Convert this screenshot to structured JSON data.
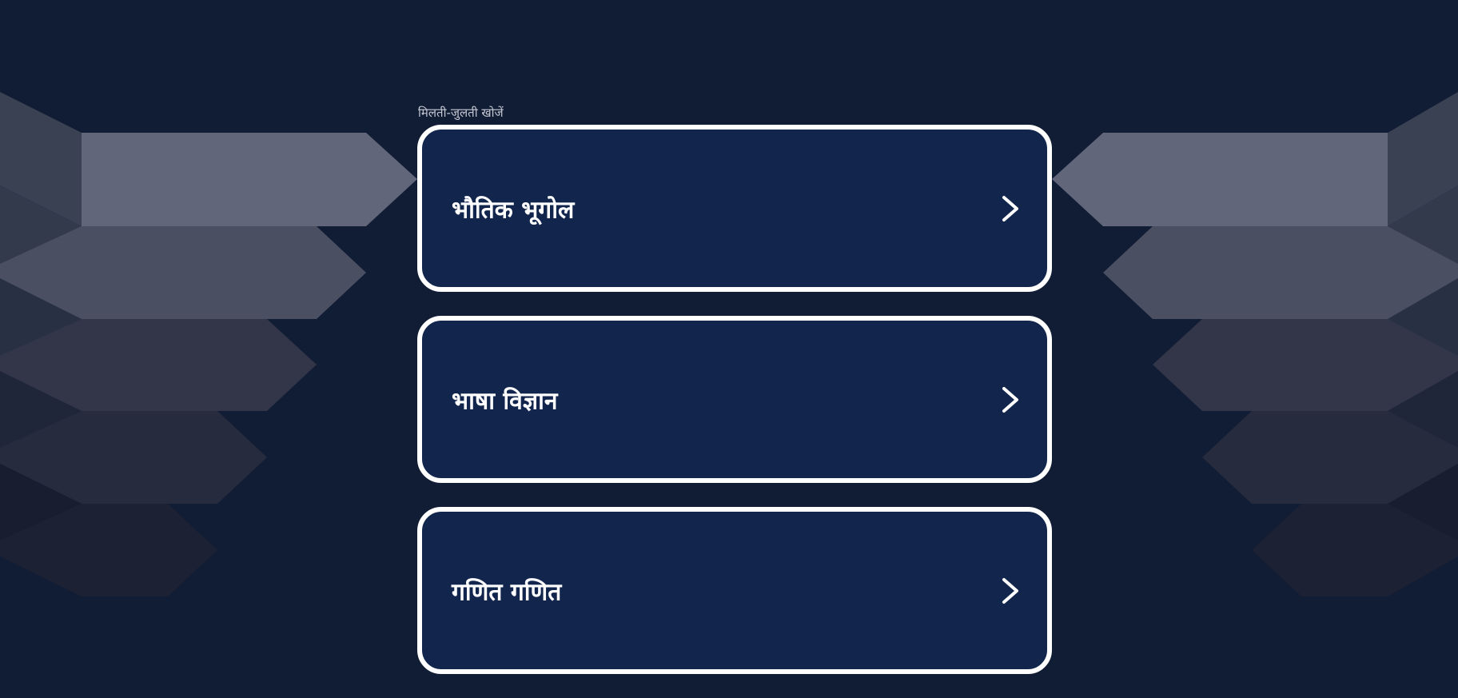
{
  "related": {
    "heading": "मिलती-जुलती खोजें",
    "items": [
      {
        "label": "भौतिक भूगोल",
        "icon": "chevron-right-icon"
      },
      {
        "label": "भाषा विज्ञान",
        "icon": "chevron-right-icon"
      },
      {
        "label": "गणित गणित",
        "icon": "chevron-right-icon"
      }
    ]
  },
  "colors": {
    "background": "#111c35",
    "card": "#12254d",
    "card_border": "#ffffff",
    "heading_text": "#c6cad4"
  }
}
